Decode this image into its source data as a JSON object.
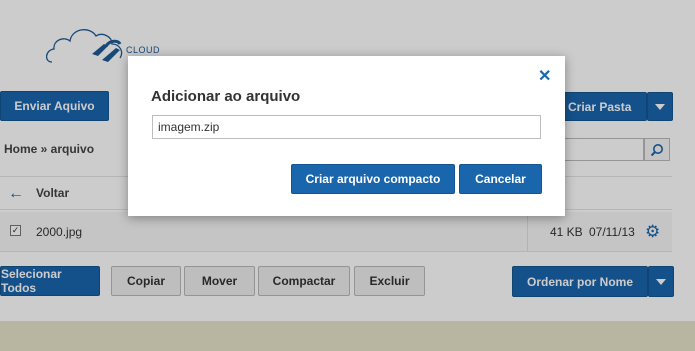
{
  "logo": {
    "text": "CLOUD"
  },
  "toolbar": {
    "send_label": "Enviar Aquivo",
    "new_folder_label": "Criar Pasta"
  },
  "breadcrumb": "Home » arquivo",
  "search": {
    "placeholder": ""
  },
  "list": {
    "back_label": "Voltar",
    "rows": [
      {
        "checked": true,
        "name": "2000.jpg",
        "size": "41 KB",
        "date": "07/11/13"
      }
    ]
  },
  "actions": {
    "select_all": "Selecionar Todos",
    "copy": "Copiar",
    "move": "Mover",
    "compress": "Compactar",
    "delete": "Excluir",
    "order": "Ordenar por Nome"
  },
  "modal": {
    "title": "Adicionar ao arquivo",
    "close": "✕",
    "input_value": "imagem.zip",
    "create_label": "Criar arquivo compacto",
    "cancel_label": "Cancelar"
  },
  "colors": {
    "accent": "#1a66ad",
    "footer": "#e6e4c8"
  }
}
